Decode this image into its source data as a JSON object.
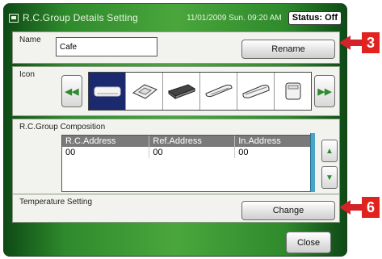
{
  "window": {
    "title": "R.C.Group Details Setting",
    "datetime": "11/01/2009 Sun. 09:20 AM",
    "status": "Status: Off"
  },
  "name_section": {
    "label": "Name",
    "value": "Cafe",
    "rename_label": "Rename"
  },
  "icon_section": {
    "label": "Icon",
    "icons": [
      "wall-mounted-unit-icon",
      "ceiling-cassette-icon",
      "ducted-unit-icon",
      "ceiling-suspended-icon",
      "ceiling-concealed-icon",
      "floor-standing-icon"
    ],
    "selected_index": 0
  },
  "group_section": {
    "label": "R.C.Group Composition",
    "columns": [
      "R.C.Address",
      "Ref.Address",
      "In.Address"
    ],
    "rows": [
      [
        "00",
        "00",
        "00"
      ]
    ]
  },
  "temperature_section": {
    "label": "Temperature Setting",
    "change_label": "Change"
  },
  "close_label": "Close",
  "callouts": [
    "3",
    "6"
  ]
}
